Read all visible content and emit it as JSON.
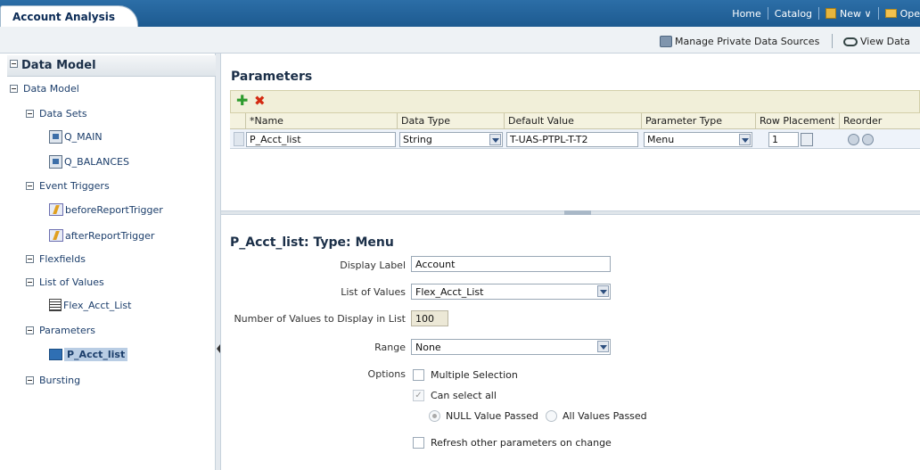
{
  "header": {
    "tab_title": "Account Analysis",
    "nav": {
      "home": "Home",
      "catalog": "Catalog",
      "new": "New ∨",
      "open": "Ope"
    }
  },
  "subbar": {
    "manage_label": "Manage Private Data Sources",
    "view_label": "View Data"
  },
  "sidebar": {
    "title": "Data Model",
    "root": "Data Model",
    "data_sets": {
      "label": "Data Sets",
      "items": [
        "Q_MAIN",
        "Q_BALANCES"
      ]
    },
    "event_triggers": {
      "label": "Event Triggers",
      "items": [
        "beforeReportTrigger",
        "afterReportTrigger"
      ]
    },
    "flexfields": "Flexfields",
    "lov": {
      "label": "List of Values",
      "items": [
        "Flex_Acct_List"
      ]
    },
    "parameters": {
      "label": "Parameters",
      "items": [
        "P_Acct_list"
      ]
    },
    "bursting": "Bursting"
  },
  "parameters": {
    "title": "Parameters",
    "columns": [
      "*Name",
      "Data Type",
      "Default Value",
      "Parameter Type",
      "Row Placement",
      "Reorder"
    ],
    "row": {
      "name": "P_Acct_list",
      "data_type": "String",
      "default_value": "T-UAS-PTPL-T-T2",
      "param_type": "Menu",
      "row_placement": "1"
    }
  },
  "detail": {
    "title": "P_Acct_list: Type: Menu",
    "display_label_label": "Display Label",
    "display_label_value": "Account",
    "lov_label": "List of Values",
    "lov_value": "Flex_Acct_List",
    "num_values_label": "Number of Values to Display in List",
    "num_values_value": "100",
    "range_label": "Range",
    "range_value": "None",
    "options_label": "Options",
    "multiple_selection": "Multiple Selection",
    "can_select_all": "Can select all",
    "null_value_passed": "NULL Value Passed",
    "all_values_passed": "All Values Passed",
    "refresh_other": "Refresh other parameters on change"
  }
}
